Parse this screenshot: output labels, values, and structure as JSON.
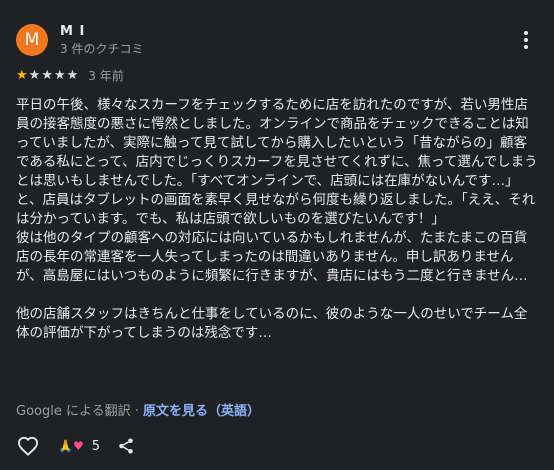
{
  "review": {
    "avatar_letter": "M",
    "user_name": "M I",
    "user_meta": "3 件のクチコミ",
    "rating": 1,
    "rating_max": 5,
    "date": "3 年前",
    "paragraphs": [
      "平日の午後、様々なスカーフをチェックするために店を訪れたのですが、若い男性店員の接客態度の悪さに愕然としました。オンラインで商品をチェックできることは知っていましたが、実際に触って見て試してから購入したいという「昔ながらの」顧客である私にとって、店内でじっくりスカーフを見させてくれずに、焦って選んでしまうとは思いもしませんでした。「すべてオンラインで、店頭には在庫がないんです…」と、店員はタブレットの画面を素早く見せながら何度も繰り返しました。「ええ、それは分かっています。でも、私は店頭で欲しいものを選びたいんです！」",
      "彼は他のタイプの顧客への対応には向いているかもしれませんが、たまたまこの百貨店の長年の常連客を一人失ってしまったのは間違いありません。申し訳ありませんが、高島屋にはいつものように頻繁に行きますが、貴店にはもう二度と行きません…",
      "",
      "他の店舗スタッフはきちんと仕事をしているのに、彼のような一人のせいでチーム全体の評価が下がってしまうのは残念です…"
    ],
    "translation_note": "Google による翻訳",
    "separator": "·",
    "original_link": "原文を見る（英語）",
    "reaction_count": "5"
  },
  "icons": {
    "more": "more-vert-icon",
    "like": "heart-outline-icon",
    "share": "share-icon",
    "reaction_1": "praying-hands-emoji",
    "reaction_2": "pink-heart-emoji"
  },
  "colors": {
    "avatar": "#f0761f",
    "star": "#fbbc04",
    "link": "#8ab4f8",
    "background": "#202124"
  }
}
